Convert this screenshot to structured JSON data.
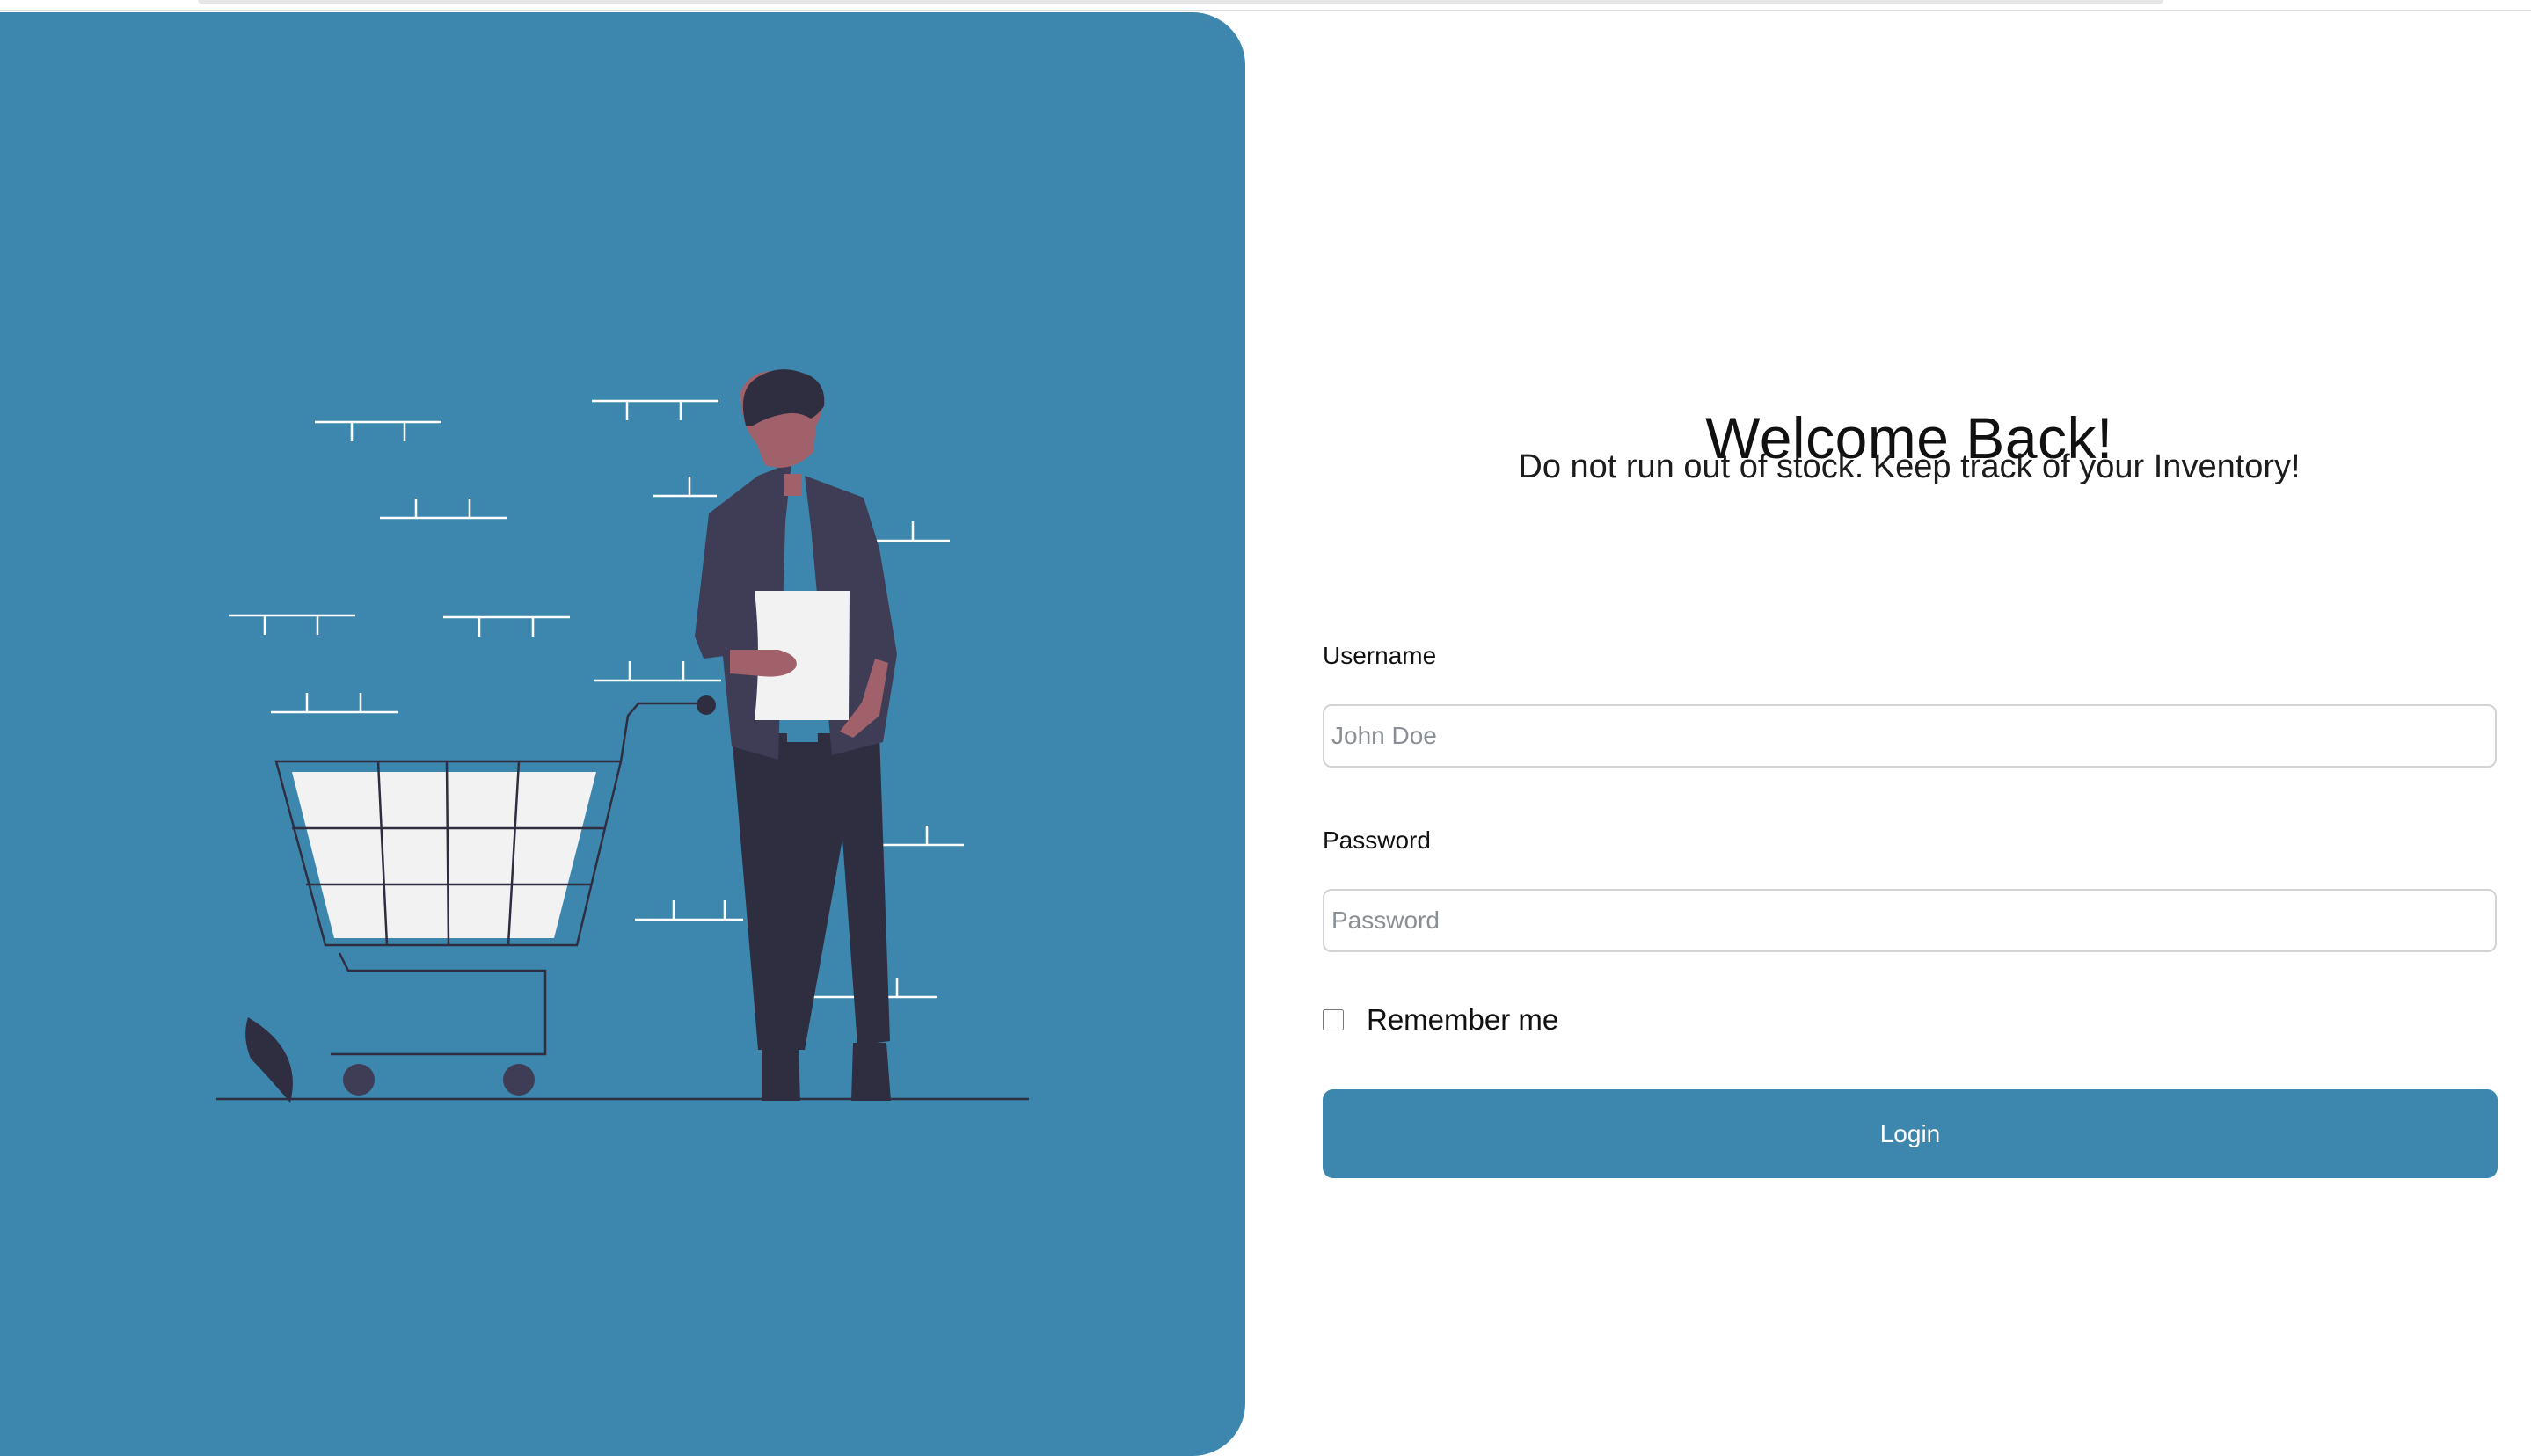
{
  "colors": {
    "accent": "#3d87ae",
    "figure_dark": "#2f2e41",
    "jacket": "#3f3d56",
    "skin": "#a0616a",
    "paper": "#f2f2f2"
  },
  "illustration": {
    "description_icon": "person-shopping-cart-illustration"
  },
  "login": {
    "title": "Welcome Back!",
    "subtitle": "Do not run out of stock. Keep track of your Inventory!",
    "username_label": "Username",
    "username_placeholder": "John Doe",
    "password_label": "Password",
    "password_placeholder": "Password",
    "remember_label": "Remember me",
    "remember_checked": false,
    "login_label": "Login"
  }
}
